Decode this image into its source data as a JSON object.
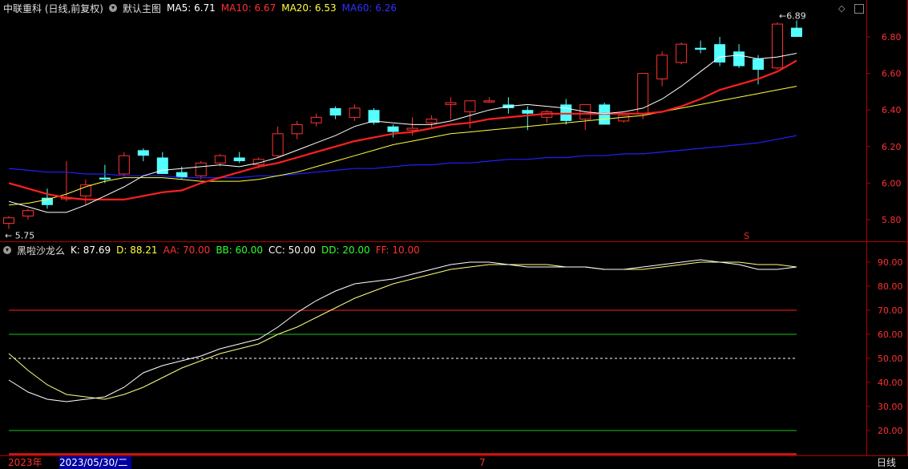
{
  "price_panel": {
    "title": "中联重科 (日线,前复权)",
    "template": "默认主图",
    "ma": [
      {
        "label": "MA5: 6.71",
        "color": "#ffffff"
      },
      {
        "label": "MA10: 6.67",
        "color": "#ff2020"
      },
      {
        "label": "MA20: 6.53",
        "color": "#ffff40"
      },
      {
        "label": "MA60: 6.26",
        "color": "#2020ff"
      }
    ],
    "high_marker": "6.89",
    "low_marker": "5.75",
    "signal_mark": "S",
    "axis": [
      "6.80",
      "6.60",
      "6.40",
      "6.20",
      "6.00",
      "5.80"
    ]
  },
  "indicator_panel": {
    "title": "黑啦沙龙么",
    "params": [
      {
        "label": "K: 87.69",
        "color": "#ffffff"
      },
      {
        "label": "D: 88.21",
        "color": "#ffff40"
      },
      {
        "label": "AA: 70.00",
        "color": "#ff2020"
      },
      {
        "label": "BB: 60.00",
        "color": "#20ff20"
      },
      {
        "label": "CC: 50.00",
        "color": "#ffffff"
      },
      {
        "label": "DD: 20.00",
        "color": "#20ff20"
      },
      {
        "label": "FF: 10.00",
        "color": "#ff2020"
      }
    ],
    "axis": [
      "90.00",
      "80.00",
      "70.00",
      "60.00",
      "50.00",
      "40.00",
      "30.00",
      "20.00"
    ]
  },
  "bottom_bar": {
    "year": "2023年",
    "date": "2023/05/30/二",
    "month_tick": "7",
    "period": "日线"
  },
  "chart_data": {
    "type": "candlestick",
    "candles": [
      [
        5.78,
        5.82,
        5.75,
        5.81
      ],
      [
        5.82,
        5.86,
        5.8,
        5.85
      ],
      [
        5.92,
        5.97,
        5.86,
        5.88
      ],
      [
        5.92,
        6.12,
        5.9,
        5.92
      ],
      [
        5.93,
        6.02,
        5.88,
        5.99
      ],
      [
        6.03,
        6.1,
        6.0,
        6.02
      ],
      [
        6.05,
        6.17,
        6.04,
        6.15
      ],
      [
        6.18,
        6.19,
        6.12,
        6.15
      ],
      [
        6.14,
        6.17,
        6.05,
        6.05
      ],
      [
        6.06,
        6.09,
        6.02,
        6.03
      ],
      [
        6.04,
        6.12,
        6.02,
        6.11
      ],
      [
        6.11,
        6.16,
        6.09,
        6.15
      ],
      [
        6.14,
        6.17,
        6.11,
        6.12
      ],
      [
        6.1,
        6.14,
        6.08,
        6.13
      ],
      [
        6.15,
        6.31,
        6.14,
        6.27
      ],
      [
        6.27,
        6.34,
        6.24,
        6.32
      ],
      [
        6.33,
        6.38,
        6.31,
        6.36
      ],
      [
        6.41,
        6.42,
        6.35,
        6.37
      ],
      [
        6.36,
        6.43,
        6.34,
        6.41
      ],
      [
        6.4,
        6.41,
        6.32,
        6.33
      ],
      [
        6.31,
        6.32,
        6.25,
        6.28
      ],
      [
        6.29,
        6.36,
        6.26,
        6.3
      ],
      [
        6.33,
        6.37,
        6.3,
        6.35
      ],
      [
        6.43,
        6.47,
        6.35,
        6.44
      ],
      [
        6.39,
        6.45,
        6.3,
        6.45
      ],
      [
        6.45,
        6.47,
        6.44,
        6.45
      ],
      [
        6.43,
        6.47,
        6.38,
        6.41
      ],
      [
        6.4,
        6.42,
        6.29,
        6.38
      ],
      [
        6.36,
        6.4,
        6.33,
        6.39
      ],
      [
        6.43,
        6.46,
        6.32,
        6.34
      ],
      [
        6.35,
        6.43,
        6.29,
        6.43
      ],
      [
        6.43,
        6.44,
        6.33,
        6.32
      ],
      [
        6.34,
        6.37,
        6.33,
        6.37
      ],
      [
        6.38,
        6.6,
        6.35,
        6.6
      ],
      [
        6.57,
        6.72,
        6.53,
        6.7
      ],
      [
        6.66,
        6.77,
        6.65,
        6.76
      ],
      [
        6.74,
        6.78,
        6.71,
        6.73
      ],
      [
        6.76,
        6.8,
        6.64,
        6.66
      ],
      [
        6.72,
        6.76,
        6.63,
        6.64
      ],
      [
        6.68,
        6.7,
        6.54,
        6.62
      ],
      [
        6.63,
        6.88,
        6.62,
        6.87
      ],
      [
        6.85,
        6.89,
        6.8,
        6.8
      ]
    ],
    "ma5": [
      5.9,
      5.87,
      5.84,
      5.84,
      5.88,
      5.93,
      5.98,
      6.04,
      6.07,
      6.08,
      6.09,
      6.1,
      6.09,
      6.11,
      6.14,
      6.18,
      6.22,
      6.26,
      6.31,
      6.34,
      6.33,
      6.32,
      6.32,
      6.34,
      6.37,
      6.4,
      6.42,
      6.43,
      6.42,
      6.41,
      6.39,
      6.38,
      6.39,
      6.41,
      6.46,
      6.53,
      6.61,
      6.69,
      6.7,
      6.68,
      6.69,
      6.71
    ],
    "ma10": [
      6.0,
      5.97,
      5.94,
      5.92,
      5.91,
      5.91,
      5.91,
      5.93,
      5.95,
      5.96,
      6.0,
      6.03,
      6.06,
      6.09,
      6.11,
      6.14,
      6.17,
      6.2,
      6.23,
      6.25,
      6.27,
      6.28,
      6.3,
      6.32,
      6.33,
      6.35,
      6.36,
      6.37,
      6.38,
      6.38,
      6.38,
      6.38,
      6.38,
      6.38,
      6.39,
      6.42,
      6.46,
      6.51,
      6.54,
      6.57,
      6.61,
      6.67
    ],
    "ma20": [
      5.88,
      5.89,
      5.91,
      5.94,
      5.98,
      6.01,
      6.03,
      6.03,
      6.03,
      6.02,
      6.01,
      6.01,
      6.01,
      6.02,
      6.04,
      6.06,
      6.09,
      6.12,
      6.15,
      6.18,
      6.21,
      6.23,
      6.25,
      6.27,
      6.28,
      6.29,
      6.3,
      6.31,
      6.32,
      6.33,
      6.34,
      6.35,
      6.36,
      6.37,
      6.39,
      6.41,
      6.43,
      6.45,
      6.47,
      6.49,
      6.51,
      6.53
    ],
    "ma60": [
      6.08,
      6.07,
      6.06,
      6.06,
      6.05,
      6.05,
      6.04,
      6.04,
      6.04,
      6.03,
      6.03,
      6.03,
      6.03,
      6.04,
      6.04,
      6.05,
      6.06,
      6.07,
      6.08,
      6.08,
      6.09,
      6.1,
      6.1,
      6.11,
      6.11,
      6.12,
      6.13,
      6.13,
      6.14,
      6.14,
      6.15,
      6.15,
      6.16,
      6.16,
      6.17,
      6.18,
      6.19,
      6.2,
      6.21,
      6.22,
      6.24,
      6.26
    ],
    "k": [
      41,
      36,
      33,
      32,
      33,
      34,
      38,
      44,
      47,
      49,
      51,
      54,
      56,
      58,
      63,
      69,
      74,
      78,
      81,
      82,
      83,
      85,
      87,
      89,
      90,
      90,
      89,
      88,
      88,
      88,
      88,
      87,
      87,
      88,
      89,
      90,
      91,
      90,
      89,
      87,
      87,
      88
    ],
    "d": [
      52,
      45,
      39,
      35,
      34,
      33,
      35,
      38,
      42,
      46,
      49,
      52,
      54,
      56,
      60,
      63,
      67,
      71,
      75,
      78,
      81,
      83,
      85,
      87,
      88,
      89,
      89,
      89,
      89,
      88,
      88,
      87,
      87,
      87,
      88,
      89,
      90,
      90,
      90,
      89,
      89,
      88
    ],
    "levels": [
      {
        "value": 70,
        "color": "#ff2020"
      },
      {
        "value": 60,
        "color": "#20c020"
      },
      {
        "value": 50,
        "color": "#ffffff"
      },
      {
        "value": 20,
        "color": "#20c020"
      },
      {
        "value": 10,
        "color": "#ff2020"
      }
    ]
  }
}
